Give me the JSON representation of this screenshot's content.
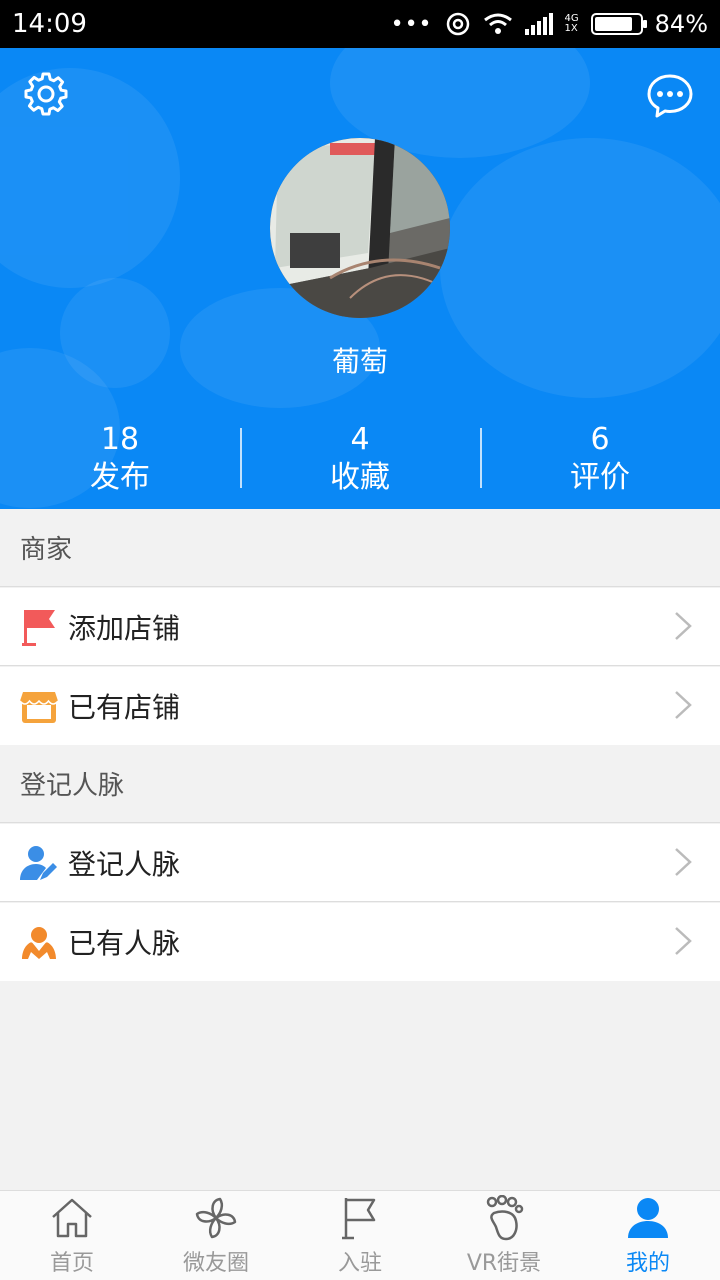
{
  "status_bar": {
    "time": "14:09",
    "network_top": "4G",
    "network_bottom": "1X",
    "battery": "84%",
    "battery_level": 0.84
  },
  "header": {
    "settings_icon": "gear-icon",
    "message_icon": "chat-bubble-icon",
    "username": "葡萄",
    "stats": [
      {
        "value": "18",
        "label": "发布"
      },
      {
        "value": "4",
        "label": "收藏"
      },
      {
        "value": "6",
        "label": "评价"
      }
    ]
  },
  "merchant": {
    "title": "商家",
    "items": [
      {
        "label": "添加店铺",
        "icon": "red-flag-icon"
      },
      {
        "label": "已有店铺",
        "icon": "storefront-icon"
      }
    ]
  },
  "contacts": {
    "title": "登记人脉",
    "items": [
      {
        "label": "登记人脉",
        "icon": "person-edit-icon"
      },
      {
        "label": "已有人脉",
        "icon": "people-hug-icon"
      }
    ]
  },
  "bottom_nav": [
    {
      "label": "首页",
      "icon": "home-icon",
      "active": false
    },
    {
      "label": "微友圈",
      "icon": "pinwheel-icon",
      "active": false
    },
    {
      "label": "入驻",
      "icon": "flag-icon",
      "active": false
    },
    {
      "label": "VR街景",
      "icon": "footprint-icon",
      "active": false
    },
    {
      "label": "我的",
      "icon": "user-icon",
      "active": true
    }
  ],
  "colors": {
    "brand_blue": "#0a88f5",
    "flag_red": "#f25a5a",
    "shop_orange": "#f5a33c",
    "person_blue": "#3b8ee6",
    "hug_orange": "#f28a2c"
  }
}
